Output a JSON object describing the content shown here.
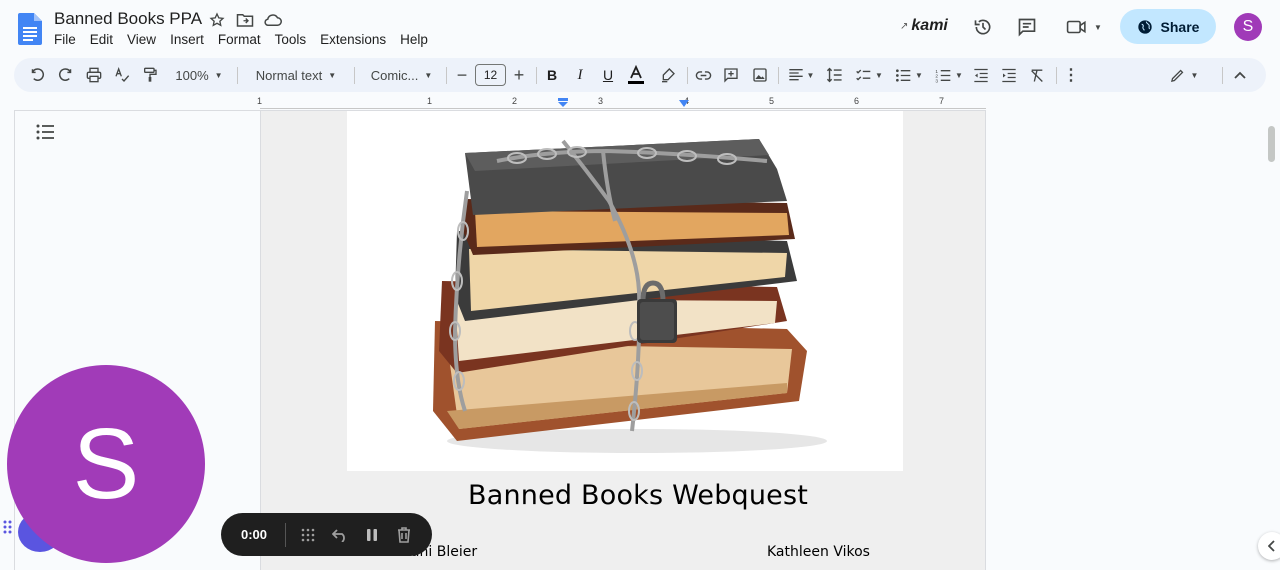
{
  "doc": {
    "title": "Banned Books PPA",
    "heading": "Banned Books Webquest",
    "author_left": "Stefani Bleier",
    "author_right": "Kathleen Vikos"
  },
  "menu": [
    "File",
    "Edit",
    "View",
    "Insert",
    "Format",
    "Tools",
    "Extensions",
    "Help"
  ],
  "header": {
    "kami_label": "kami",
    "share_label": "Share",
    "avatar_letter": "S"
  },
  "toolbar": {
    "zoom": "100%",
    "style": "Normal text",
    "font": "Comic...",
    "font_size": "12"
  },
  "ruler": [
    "1",
    "1",
    "2",
    "3",
    "4",
    "5",
    "6",
    "7"
  ],
  "recorder": {
    "time": "0:00"
  },
  "overlay": {
    "avatar_letter": "S"
  },
  "colors": {
    "accent_blue": "#c2e7ff",
    "avatar_purple": "#a13bb8",
    "toolbar_bg": "#edf2fa"
  }
}
